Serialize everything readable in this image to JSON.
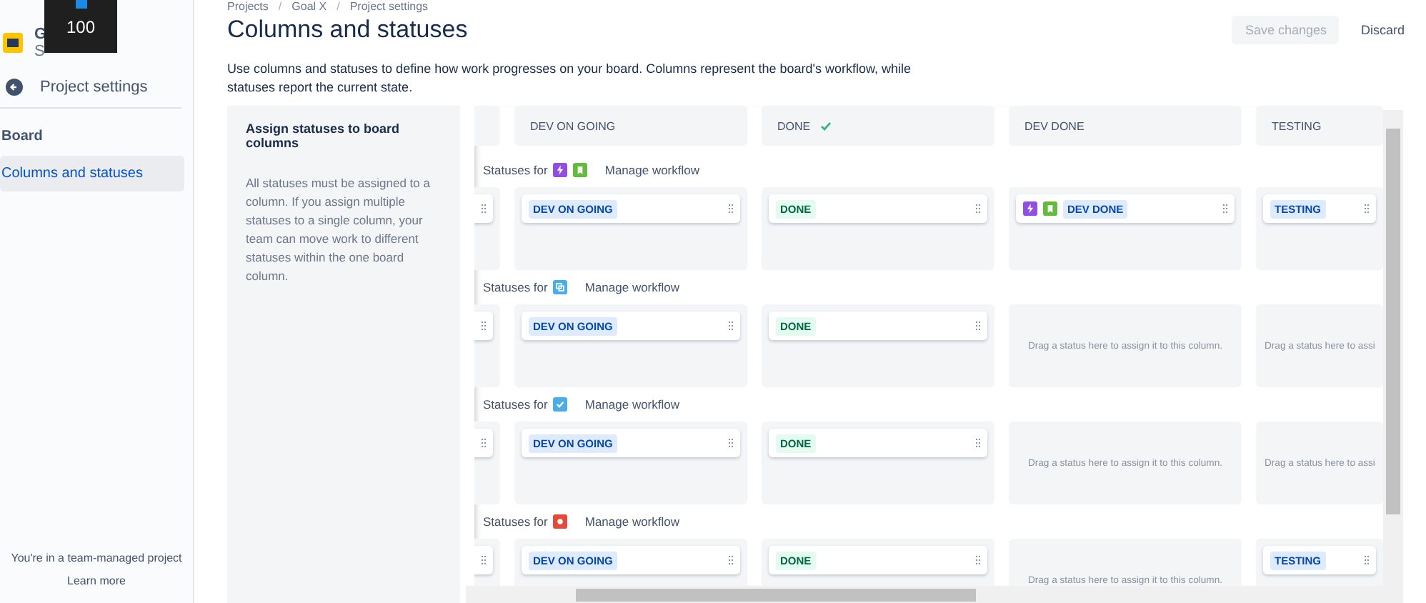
{
  "overlay": {
    "label": "100"
  },
  "sidebar": {
    "project": {
      "name": "G",
      "type": "S"
    },
    "back": {
      "label": "Project settings"
    },
    "section": "Board",
    "items": [
      {
        "label": "Columns and statuses",
        "selected": true
      }
    ],
    "footer": {
      "text": "You're in a team-managed project",
      "link": "Learn more"
    }
  },
  "breadcrumbs": [
    {
      "kind": "link",
      "text": "Projects"
    },
    {
      "kind": "separator",
      "text": "/"
    },
    {
      "kind": "link",
      "text": "Goal X"
    },
    {
      "kind": "separator",
      "text": "/"
    },
    {
      "kind": "link",
      "text": "Project settings"
    }
  ],
  "title": "Columns and statuses",
  "actions": [
    {
      "label": "Save changes",
      "disabled": true
    },
    {
      "label": "Discard",
      "disabled": false
    }
  ],
  "description": "Use columns and statuses to define how work progresses on your board. Columns represent the board's workflow, while statuses report the current state.",
  "info_panel": {
    "title": "Assign statuses to board columns",
    "text": "All statuses must be assigned to a column. If you assign multiple statuses to a single column, your team can move work to different statuses within the one board column."
  },
  "columns": [
    {
      "done": false
    },
    {
      "name": "DEV ON GOING",
      "done": false
    },
    {
      "name": "DONE",
      "done": true
    },
    {
      "name": "DEV DONE",
      "done": false
    },
    {
      "name": "TESTING",
      "done": false
    }
  ],
  "workflows": [
    {
      "label": "Statuses for",
      "link": "Manage workflow",
      "types": [
        {
          "kind": "epic",
          "color": "#904ee2"
        },
        {
          "kind": "story",
          "color": "#63ba3c"
        }
      ],
      "cells": [
        {
          "kind": "status"
        },
        {
          "kind": "status",
          "status": "DEV ON GOING",
          "done": false
        },
        {
          "kind": "status",
          "status": "DONE",
          "done": true
        },
        {
          "kind": "status",
          "status": "DEV DONE",
          "done": false,
          "types": [
            {
              "kind": "epic",
              "color": "#904ee2"
            },
            {
              "kind": "story",
              "color": "#63ba3c"
            }
          ]
        },
        {
          "kind": "status",
          "status": "TESTING",
          "done": false
        }
      ]
    },
    {
      "label": "Statuses for",
      "link": "Manage workflow",
      "types": [
        {
          "kind": "subtask",
          "color": "#4bade8"
        }
      ],
      "cells": [
        {
          "kind": "status"
        },
        {
          "kind": "status",
          "status": "DEV ON GOING",
          "done": false
        },
        {
          "kind": "status",
          "status": "DONE",
          "done": true
        },
        {
          "kind": "empty",
          "text": "Drag a status here to assign it to this column."
        },
        {
          "kind": "empty",
          "text": "Drag a status here to assi"
        }
      ]
    },
    {
      "label": "Statuses for",
      "link": "Manage workflow",
      "types": [
        {
          "kind": "task",
          "color": "#4bade8"
        }
      ],
      "cells": [
        {
          "kind": "status"
        },
        {
          "kind": "status",
          "status": "DEV ON GOING",
          "done": false
        },
        {
          "kind": "status",
          "status": "DONE",
          "done": true
        },
        {
          "kind": "empty",
          "text": "Drag a status here to assign it to this column."
        },
        {
          "kind": "empty",
          "text": "Drag a status here to assi"
        }
      ]
    },
    {
      "label": "Statuses for",
      "link": "Manage workflow",
      "types": [
        {
          "kind": "bug",
          "color": "#e5493a"
        }
      ],
      "cells": [
        {
          "kind": "status"
        },
        {
          "kind": "status",
          "status": "DEV ON GOING",
          "done": false
        },
        {
          "kind": "status",
          "status": "DONE",
          "done": true
        },
        {
          "kind": "empty",
          "text": "Drag a status here to assign it to this column."
        },
        {
          "kind": "status",
          "status": "TESTING",
          "done": false
        }
      ]
    }
  ]
}
